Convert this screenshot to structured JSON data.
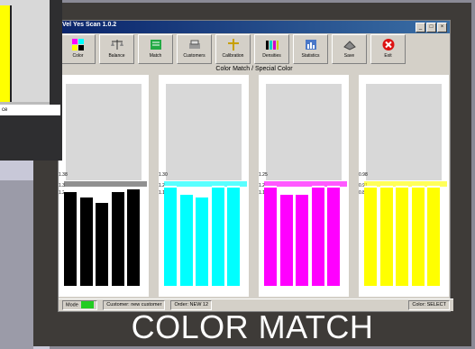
{
  "window": {
    "title": "Vel Yes Scan 1.0.2",
    "controls": [
      "_",
      "□",
      "×"
    ]
  },
  "toolbar": [
    {
      "label": "Color",
      "icon": "color-blocks-icon"
    },
    {
      "label": "Balance",
      "icon": "scale-icon"
    },
    {
      "label": "Match",
      "icon": "match-icon"
    },
    {
      "label": "Customers",
      "icon": "customers-icon"
    },
    {
      "label": "Calibration",
      "icon": "calibration-icon"
    },
    {
      "label": "Densities",
      "icon": "densities-icon"
    },
    {
      "label": "Statistics",
      "icon": "statistics-icon"
    },
    {
      "label": "Save",
      "icon": "save-icon"
    },
    {
      "label": "Exit",
      "icon": "exit-icon"
    }
  ],
  "panel": {
    "title": "Color Match / Special Color"
  },
  "columns": [
    {
      "color": "#000000",
      "ticks": [
        "1.38",
        "1.3",
        "1.24"
      ],
      "bar_levels": [
        0.72,
        0.68,
        0.64,
        0.72,
        0.74
      ]
    },
    {
      "color": "#00ffff",
      "ticks": [
        "1.30",
        "1.2",
        "1.16"
      ],
      "bar_levels": [
        0.76,
        0.7,
        0.68,
        0.76,
        0.76
      ]
    },
    {
      "color": "#ff00ff",
      "ticks": [
        "1.25",
        "1.2",
        "1.17"
      ],
      "bar_levels": [
        0.76,
        0.7,
        0.7,
        0.76,
        0.76
      ]
    },
    {
      "color": "#ffff00",
      "ticks": [
        "0.98",
        "0.91",
        "0.88"
      ],
      "bar_levels": [
        0.76,
        0.76,
        0.76,
        0.76,
        0.76
      ]
    }
  ],
  "status": {
    "mode_label": "Mode",
    "customer": "Customer: new customer",
    "order": "Order: NEW 12",
    "color": "Color: SELECT"
  },
  "popup": {
    "label": "ce"
  },
  "caption": "COLOR MATCH"
}
